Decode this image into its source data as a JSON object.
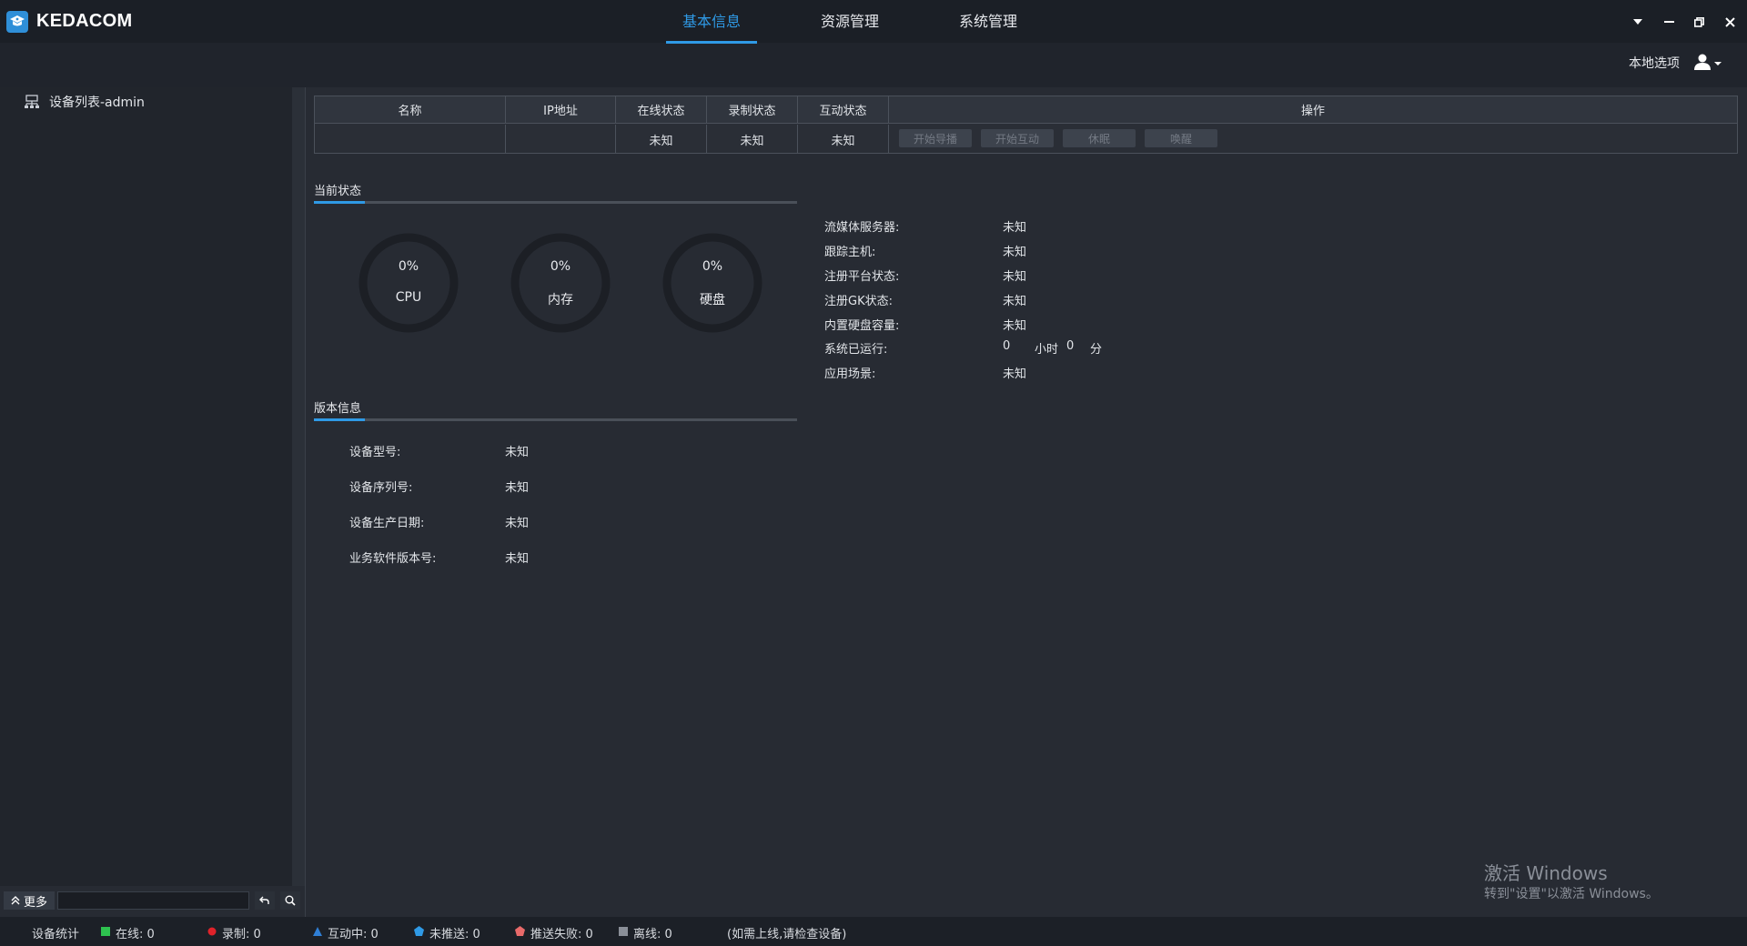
{
  "app": {
    "title": "KEDACOM"
  },
  "nav": {
    "tabs": [
      "基本信息",
      "资源管理",
      "系统管理"
    ],
    "local_options": "本地选项"
  },
  "sidebar": {
    "root_label": "设备列表-admin",
    "more_label": "更多",
    "search_value": ""
  },
  "table": {
    "headers": [
      "名称",
      "IP地址",
      "在线状态",
      "录制状态",
      "互动状态",
      "操作"
    ],
    "row": {
      "name": "",
      "ip": "",
      "online": "未知",
      "recording": "未知",
      "interaction": "未知"
    },
    "actions": [
      "开始导播",
      "开始互动",
      "休眠",
      "唤醒"
    ]
  },
  "current_status": {
    "title": "当前状态",
    "gauges": [
      {
        "value": "0%",
        "label": "CPU",
        "percent": 0
      },
      {
        "value": "0%",
        "label": "内存",
        "percent": 0
      },
      {
        "value": "0%",
        "label": "硬盘",
        "percent": 0
      }
    ],
    "items": [
      {
        "label": "流媒体服务器:",
        "value": "未知"
      },
      {
        "label": "跟踪主机:",
        "value": "未知"
      },
      {
        "label": "注册平台状态:",
        "value": "未知"
      },
      {
        "label": "注册GK状态:",
        "value": "未知"
      },
      {
        "label": "内置硬盘容量:",
        "value": "未知"
      },
      {
        "label": "应用场景:",
        "value": "未知"
      }
    ],
    "uptime": {
      "label": "系统已运行:",
      "hours": "0",
      "hours_unit": "小时",
      "minutes": "0",
      "minutes_unit": "分"
    }
  },
  "version_info": {
    "title": "版本信息",
    "items": [
      {
        "label": "设备型号:",
        "value": "未知"
      },
      {
        "label": "设备序列号:",
        "value": "未知"
      },
      {
        "label": "设备生产日期:",
        "value": "未知"
      },
      {
        "label": "业务软件版本号:",
        "value": "未知"
      }
    ]
  },
  "statusbar": {
    "title": "设备统计",
    "online": "在线: 0",
    "recording": "录制: 0",
    "interacting": "互动中: 0",
    "not_pushed": "未推送: 0",
    "push_failed": "推送失败: 0",
    "offline": "离线: 0",
    "hint": "(如需上线,请检查设备)"
  },
  "watermark": {
    "line1": "激活 Windows",
    "line2": "转到\"设置\"以激活 Windows。"
  },
  "colors": {
    "accent": "#2f9ae6",
    "online": "#2ec24f",
    "recording": "#e0222a",
    "interacting": "#2f7fd6",
    "not_pushed": "#2f9ae6",
    "push_failed": "#e86a6a",
    "offline": "#8a8f98"
  }
}
